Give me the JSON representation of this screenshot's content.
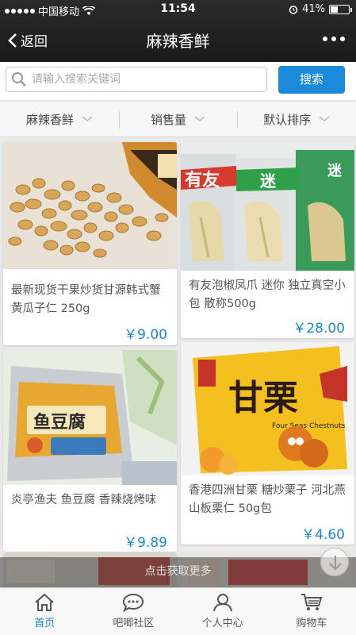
{
  "status_bar": {
    "carrier": "中国移动",
    "time": "11:54",
    "battery": "41%",
    "battery_level": 0.41
  },
  "header": {
    "back_label": "返回",
    "title": "麻辣香鲜"
  },
  "search": {
    "placeholder": "请输入搜索关键词",
    "value": "",
    "button_label": "搜索"
  },
  "filters": [
    {
      "label": "麻辣香鲜"
    },
    {
      "label": "销售量"
    },
    {
      "label": "默认排序"
    }
  ],
  "products": [
    {
      "name": "最新现货干果炒货甘源韩式蟹黄瓜子仁 250g",
      "price": "￥9.00"
    },
    {
      "name": "有友泡椒凤爪 迷你 独立真空小包 散称500g",
      "price": "￥28.00"
    },
    {
      "name": "炎亭渔夫 鱼豆腐 香辣烧烤味",
      "price": "￥9.89"
    },
    {
      "name": "香港四洲甘栗 糖炒栗子 河北燕山板栗仁 50g包",
      "price": "￥4.60"
    }
  ],
  "package_labels": {
    "p2_brand": "有友",
    "p2_tag": "迷",
    "p3_brand": "鱼豆腐",
    "p4_brand": "甘栗",
    "p4_sub": "Four Seas Chestnuts"
  },
  "load_more": "点击获取更多",
  "tabbar": [
    {
      "label": "首页",
      "icon": "home-icon",
      "active": true
    },
    {
      "label": "吧唧社区",
      "icon": "chat-bubble-icon",
      "active": false
    },
    {
      "label": "个人中心",
      "icon": "user-icon",
      "active": false
    },
    {
      "label": "购物车",
      "icon": "cart-icon",
      "active": false
    }
  ],
  "colors": {
    "accent": "#1b87d2",
    "header_bg": "#222222",
    "search_button": "#1b8ad9"
  }
}
